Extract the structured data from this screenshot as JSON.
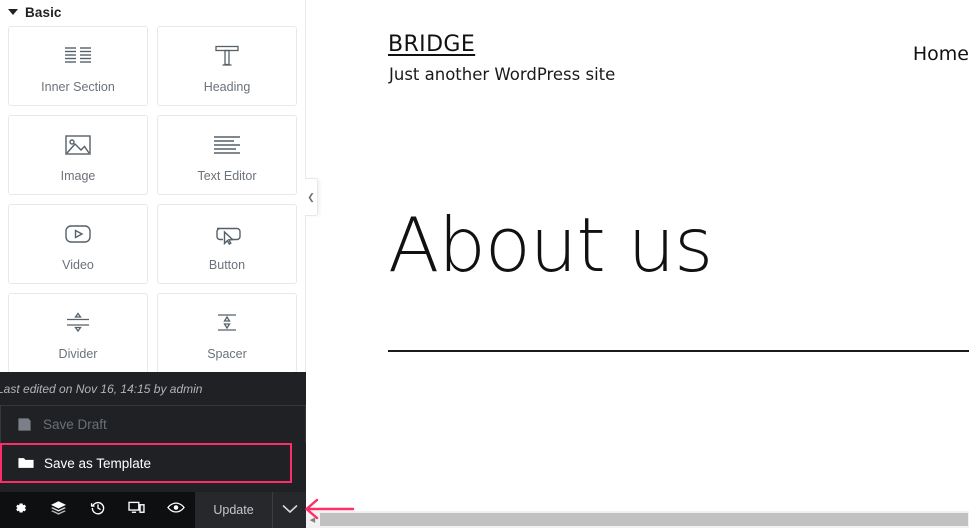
{
  "panel": {
    "section": {
      "title": "Basic",
      "caret_icon": "caret-down-icon",
      "expanded": true
    },
    "widgets": [
      {
        "label": "Inner Section",
        "icon": "inner-section-icon"
      },
      {
        "label": "Heading",
        "icon": "heading-t-icon"
      },
      {
        "label": "Image",
        "icon": "image-icon"
      },
      {
        "label": "Text Editor",
        "icon": "text-editor-icon"
      },
      {
        "label": "Video",
        "icon": "video-play-icon"
      },
      {
        "label": "Button",
        "icon": "button-cursor-icon"
      },
      {
        "label": "Divider",
        "icon": "divider-icon"
      },
      {
        "label": "Spacer",
        "icon": "spacer-icon"
      }
    ],
    "collapse_handle": {
      "icon": "chevron-left-icon"
    }
  },
  "save_menu": {
    "last_edited": "Last edited on Nov 16, 14:15 by admin",
    "items": [
      {
        "label": "Save Draft",
        "icon": "floppy-save-icon",
        "state": "disabled",
        "highlighted": false
      },
      {
        "label": "Save as Template",
        "icon": "folder-icon",
        "state": "enabled",
        "highlighted": true
      }
    ],
    "highlight_color": "#ff2d67"
  },
  "footer": {
    "tools": [
      {
        "name": "settings",
        "icon": "gear-icon",
        "title": "Settings"
      },
      {
        "name": "navigator",
        "icon": "layers-icon",
        "title": "Navigator"
      },
      {
        "name": "history",
        "icon": "history-clock-icon",
        "title": "History"
      },
      {
        "name": "responsive",
        "icon": "responsive-devices-icon",
        "title": "Responsive Mode"
      },
      {
        "name": "preview",
        "icon": "eye-icon",
        "title": "Preview Changes"
      }
    ],
    "update_label": "Update",
    "update_caret_icon": "chevron-down-icon"
  },
  "preview": {
    "site_title": "BRIDGE",
    "tagline": "Just another WordPress site",
    "nav": [
      {
        "label": "Home"
      }
    ],
    "page_title": "About us"
  },
  "scrollbar": {
    "left_arrow_icon": "triangle-left-icon"
  },
  "annotation": {
    "arrow_icon": "arrow-left-annotation",
    "color": "#ff2d67"
  }
}
